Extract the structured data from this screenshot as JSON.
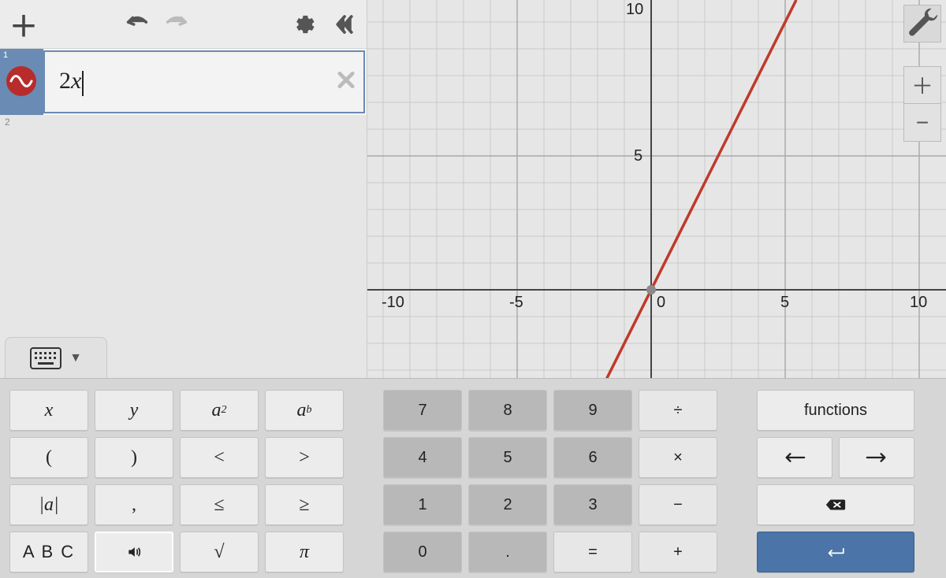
{
  "sidebar": {
    "rows": [
      {
        "index": "1",
        "expression": "2x"
      },
      {
        "index": "2"
      }
    ]
  },
  "chart_data": {
    "type": "line",
    "title": "",
    "xlabel": "",
    "ylabel": "",
    "xlim": [
      -11,
      11
    ],
    "ylim": [
      -3,
      11
    ],
    "xticks": [
      -10,
      -5,
      0,
      5,
      10
    ],
    "yticks": [
      5,
      10
    ],
    "series": [
      {
        "name": "y = 2x",
        "color": "#c0392b",
        "points": [
          [
            -2,
            -4
          ],
          [
            0,
            0
          ],
          [
            5,
            10
          ]
        ]
      }
    ],
    "x_tick_labels": {
      "neg10": "-10",
      "neg5": "-5",
      "zero": "0",
      "pos5": "5",
      "pos10": "10"
    },
    "y_tick_labels": {
      "five": "5",
      "ten": "10"
    }
  },
  "keyboard": {
    "alg": {
      "x": "x",
      "y": "y",
      "a2_base": "a",
      "a2_sup": "2",
      "ab_base": "a",
      "ab_sup": "b",
      "lparen": "(",
      "rparen": ")",
      "lt": "<",
      "gt": ">",
      "abs": "|a|",
      "comma": ",",
      "le": "≤",
      "ge": "≥",
      "abc": "A B C",
      "sqrt": "√",
      "pi": "π"
    },
    "num": {
      "7": "7",
      "8": "8",
      "9": "9",
      "div": "÷",
      "4": "4",
      "5": "5",
      "6": "6",
      "mul": "×",
      "1": "1",
      "2": "2",
      "3": "3",
      "sub": "−",
      "0": "0",
      "dot": ".",
      "eq": "=",
      "add": "+"
    },
    "nav": {
      "functions": "functions"
    }
  }
}
